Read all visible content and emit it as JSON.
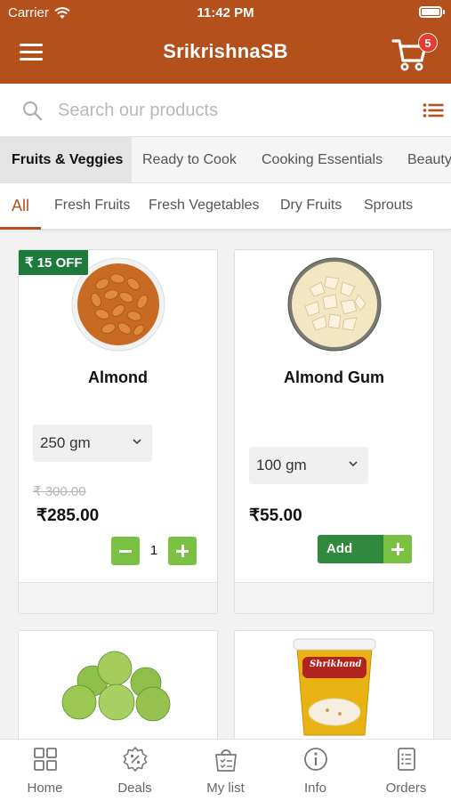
{
  "status": {
    "carrier": "Carrier",
    "time": "11:42 PM"
  },
  "header": {
    "title": "SrikrishnaSB",
    "cart_count": "5"
  },
  "search": {
    "placeholder": "Search our products"
  },
  "categories": [
    "Fruits & Veggies",
    "Ready to Cook",
    "Cooking Essentials",
    "Beauty"
  ],
  "subcategories": [
    "All",
    "Fresh Fruits",
    "Fresh Vegetables",
    "Dry Fruits",
    "Sprouts"
  ],
  "products": [
    {
      "discount": "₹ 15 OFF",
      "name": "Almond",
      "weight": "250 gm",
      "mrp": "₹ 300.00",
      "price": "₹285.00",
      "quantity": "1"
    },
    {
      "name": "Almond Gum",
      "weight": "100 gm",
      "price": "₹55.00",
      "add_label": "Add"
    },
    {
      "name": ""
    },
    {
      "name": "",
      "image_text": "Shrikhand"
    }
  ],
  "tabs": [
    "Home",
    "Deals",
    "My list",
    "Info",
    "Orders"
  ],
  "colors": {
    "brand": "#b3501b",
    "green_dark": "#2f8a3e",
    "green_light": "#7ac142",
    "badge": "#e33b2e"
  }
}
